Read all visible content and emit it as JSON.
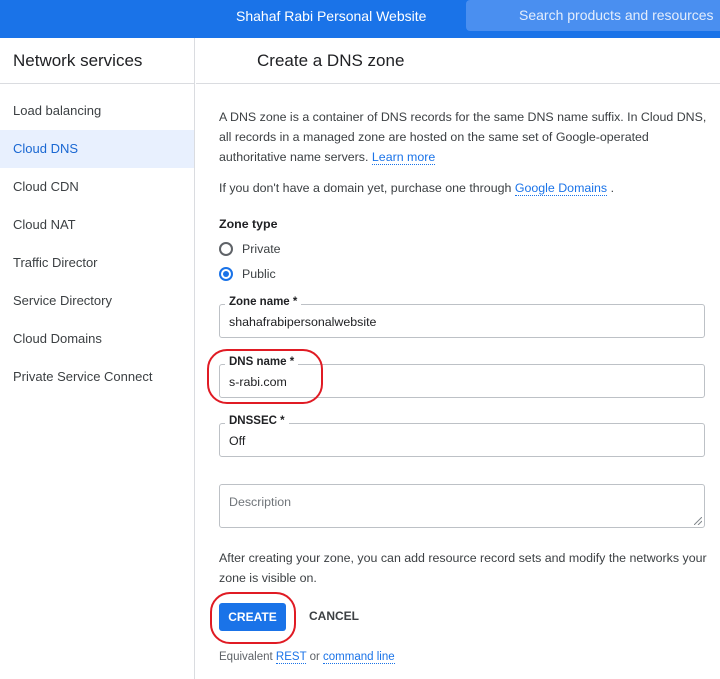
{
  "topbar": {
    "project": "Shahaf Rabi Personal Website",
    "search_placeholder": "Search products and resources"
  },
  "sidebar": {
    "title": "Network services",
    "items": [
      {
        "label": "Load balancing"
      },
      {
        "label": "Cloud DNS",
        "active": true
      },
      {
        "label": "Cloud CDN"
      },
      {
        "label": "Cloud NAT"
      },
      {
        "label": "Traffic Director"
      },
      {
        "label": "Service Directory"
      },
      {
        "label": "Cloud Domains"
      },
      {
        "label": "Private Service Connect"
      }
    ]
  },
  "page": {
    "title": "Create a DNS zone",
    "intro_line1": "A DNS zone is a container of DNS records for the same DNS name suffix. In Cloud DNS,",
    "intro_line2": "all records in a managed zone are hosted on the same set of Google-operated",
    "intro_line3": "authoritative name servers.",
    "learn_more": "Learn more",
    "domain_text": "If you don't have a domain yet, purchase one through",
    "google_domains": "Google Domains",
    "domain_tail": ".",
    "zone_type_label": "Zone type",
    "radio_private": "Private",
    "radio_public": "Public",
    "selected_zone_type": "Public",
    "zone_name_label": "Zone name *",
    "zone_name_value": "shahafrabipersonalwebsite",
    "dns_name_label": "DNS name *",
    "dns_name_value": "s-rabi.com",
    "dnssec_label": "DNSSEC *",
    "dnssec_value": "Off",
    "description_placeholder": "Description",
    "after_line1": "After creating your zone, you can add resource record sets and modify the networks your",
    "after_line2": "zone is visible on.",
    "create_label": "CREATE",
    "cancel_label": "CANCEL",
    "equivalent": "Equivalent",
    "rest": "REST",
    "or": "or",
    "command_line": "command line"
  },
  "colors": {
    "accent": "#1a73e8",
    "highlight_circle": "#e01b24"
  }
}
